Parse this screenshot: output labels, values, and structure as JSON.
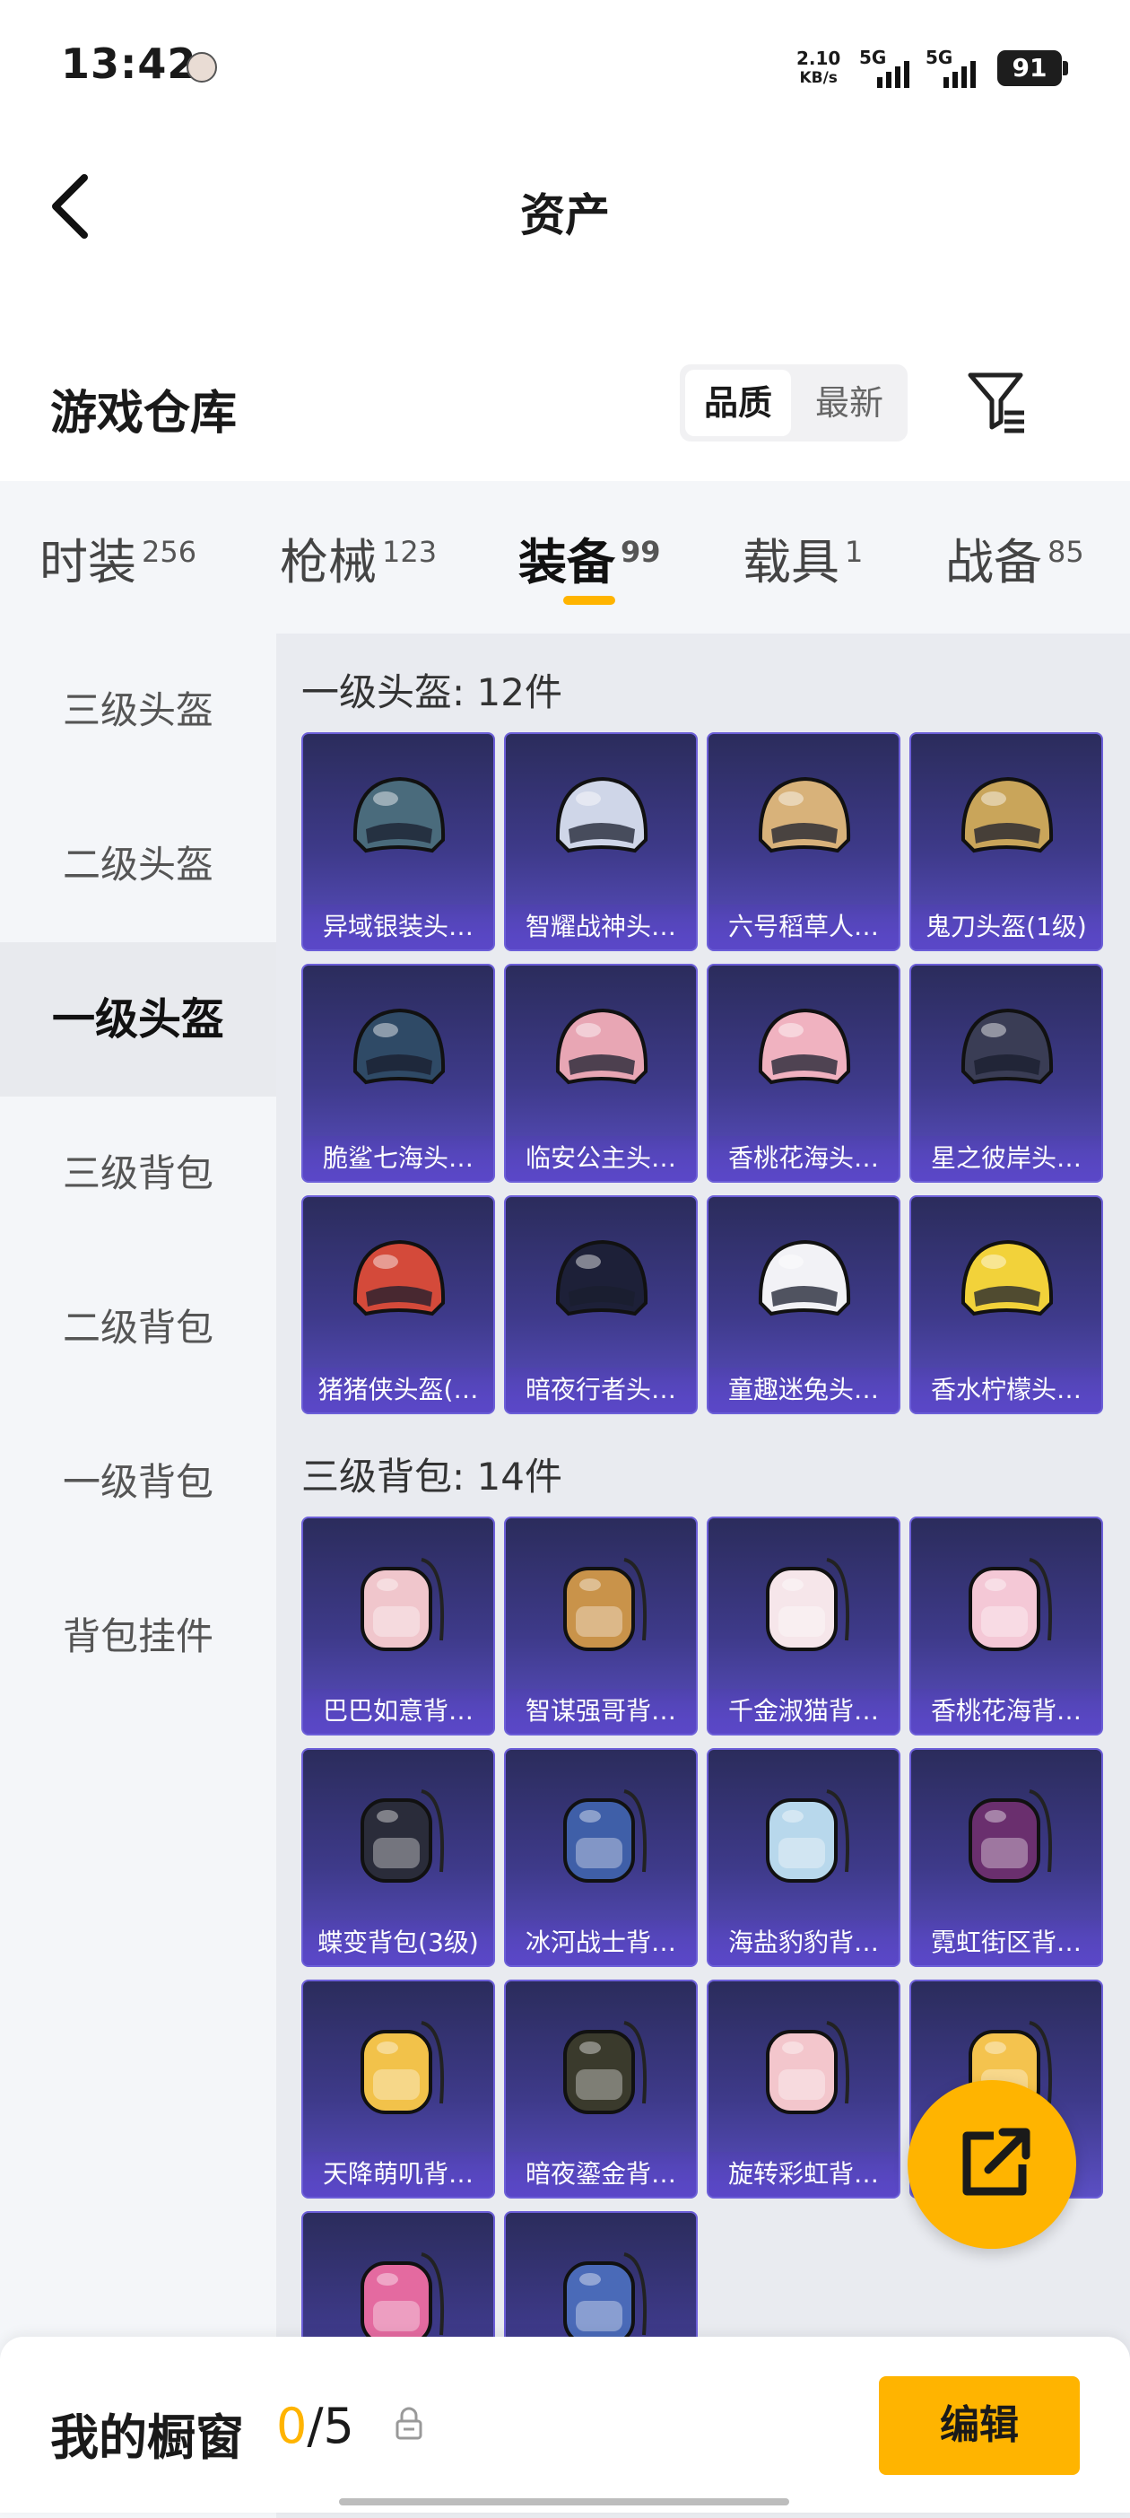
{
  "status_bar": {
    "time": "13:42",
    "net_speed_value": "2.10",
    "net_speed_unit": "KB/s",
    "sim1": "5G",
    "sim2": "5G",
    "battery": "91"
  },
  "header": {
    "title": "资产"
  },
  "warehouse": {
    "title": "游戏仓库",
    "sort_quality": "品质",
    "sort_latest": "最新"
  },
  "tabs": [
    {
      "label": "时装",
      "count": "256"
    },
    {
      "label": "枪械",
      "count": "123"
    },
    {
      "label": "装备",
      "count": "99"
    },
    {
      "label": "载具",
      "count": "1"
    },
    {
      "label": "战备",
      "count": "85"
    }
  ],
  "sidebar": {
    "items": [
      "三级头盔",
      "二级头盔",
      "一级头盔",
      "三级背包",
      "二级背包",
      "一级背包",
      "背包挂件"
    ]
  },
  "sections": [
    {
      "title": "一级头盔: 12件",
      "items": [
        "异域银装头…",
        "智耀战神头…",
        "六号稻草人…",
        "鬼刀头盔(1级)",
        "脆鲨七海头…",
        "临安公主头…",
        "香桃花海头…",
        "星之彼岸头…",
        "猪猪侠头盔(…",
        "暗夜行者头…",
        "童趣迷兔头…",
        "香水柠檬头…"
      ]
    },
    {
      "title": "三级背包: 14件",
      "items": [
        "巴巴如意背…",
        "智谋强哥背…",
        "千金淑猫背…",
        "香桃花海背…",
        "蝶变背包(3级)",
        "冰河战士背…",
        "海盐豹豹背…",
        "霓虹街区背…",
        "天降萌叽背…",
        "暗夜鎏金背…",
        "旋转彩虹背…",
        "",
        "",
        ""
      ]
    }
  ],
  "bottom": {
    "showcase_label": "我的橱窗",
    "count_current": "0",
    "count_sep": "/5",
    "edit": "编辑"
  }
}
